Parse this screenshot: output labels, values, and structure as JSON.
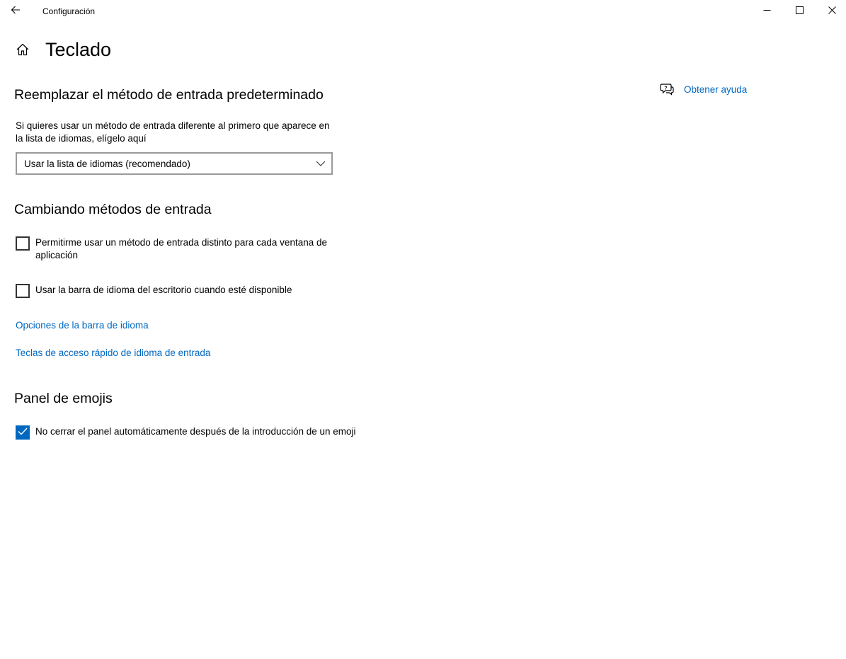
{
  "window": {
    "title": "Configuración",
    "icons": {
      "back": "arrow-left-icon",
      "minimize": "minimize-icon",
      "maximize": "maximize-icon",
      "close": "close-icon"
    }
  },
  "page": {
    "title": "Teclado",
    "home_icon": "home-icon"
  },
  "help": {
    "label": "Obtener ayuda",
    "icon": "chat-help-icon"
  },
  "input_method": {
    "heading": "Reemplazar el método de entrada predeterminado",
    "description": "Si quieres usar un método de entrada diferente al primero que aparece en la lista de idiomas, elígelo aquí",
    "dropdown_value": "Usar la lista de idiomas (recomendado)"
  },
  "switching": {
    "heading": "Cambiando métodos de entrada",
    "checkbox_per_app": {
      "label": "Permitirme usar un método de entrada distinto para cada ventana de aplicación",
      "checked": false
    },
    "checkbox_language_bar": {
      "label": "Usar la barra de idioma del escritorio cuando esté disponible",
      "checked": false
    },
    "link_language_bar_options": "Opciones de la barra de idioma",
    "link_hotkeys": "Teclas de acceso rápido de idioma de entrada"
  },
  "emoji": {
    "heading": "Panel de emojis",
    "checkbox_keep_open": {
      "label": "No cerrar el panel automáticamente después de la introducción de un emoji",
      "checked": true
    }
  },
  "colors": {
    "accent": "#0067c0",
    "link": "#0067c0",
    "text": "#000000",
    "background": "#ffffff"
  }
}
